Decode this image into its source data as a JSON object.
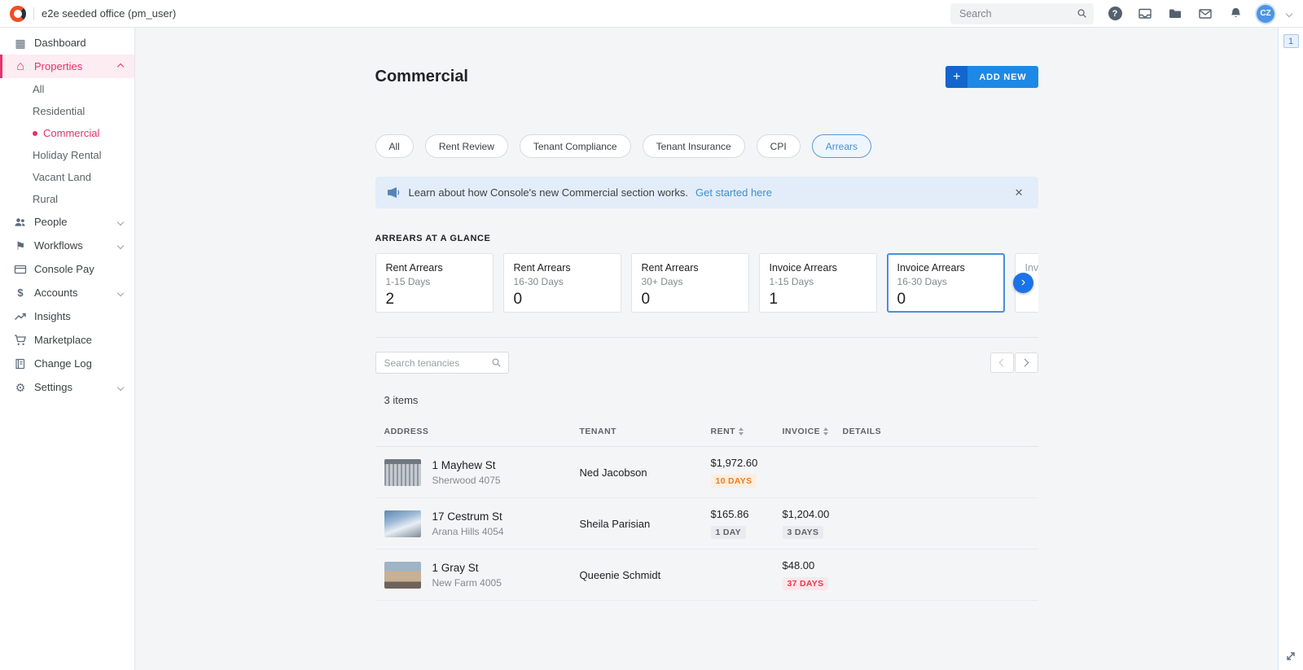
{
  "colors": {
    "brand_pink": "#e8316b",
    "brand_blue": "#1e88e5",
    "accent_blue": "#1a73e8",
    "badge_orange": "#ee7a23",
    "badge_gray": "#5f6368",
    "badge_red": "#e8384f",
    "banner_bg": "#e3edf9"
  },
  "icons": {
    "grid_glyph": "▦",
    "home_glyph": "⌂",
    "flag_glyph": "⚑",
    "gear_glyph": "⚙",
    "dollar_glyph": "$",
    "help_glyph": "?",
    "plus_glyph": "+",
    "close_glyph": "✕",
    "chevron_right_glyph": "›"
  },
  "topbar": {
    "workspace": "e2e seeded office (pm_user)",
    "search_placeholder": "Search",
    "avatar": "CZ"
  },
  "sidebar": {
    "items": [
      {
        "icon": "grid-icon",
        "label": "Dashboard"
      },
      {
        "icon": "home-icon",
        "label": "Properties",
        "active": true,
        "expanded": true
      },
      {
        "icon": "people-icon",
        "label": "People",
        "expandable": true
      },
      {
        "icon": "flag-icon",
        "label": "Workflows",
        "expandable": true
      },
      {
        "icon": "card-icon",
        "label": "Console Pay"
      },
      {
        "icon": "dollar-icon",
        "label": "Accounts",
        "expandable": true
      },
      {
        "icon": "trend-icon",
        "label": "Insights"
      },
      {
        "icon": "cart-icon",
        "label": "Marketplace"
      },
      {
        "icon": "book-icon",
        "label": "Change Log"
      },
      {
        "icon": "gear-icon",
        "label": "Settings",
        "expandable": true
      }
    ],
    "properties_sub": [
      {
        "label": "All"
      },
      {
        "label": "Residential"
      },
      {
        "label": "Commercial",
        "active": true
      },
      {
        "label": "Holiday Rental"
      },
      {
        "label": "Vacant Land"
      },
      {
        "label": "Rural"
      }
    ]
  },
  "main": {
    "page_title": "Commercial",
    "add_new_label": "ADD NEW",
    "filters": [
      {
        "label": "All"
      },
      {
        "label": "Rent Review"
      },
      {
        "label": "Tenant Compliance"
      },
      {
        "label": "Tenant Insurance"
      },
      {
        "label": "CPI"
      },
      {
        "label": "Arrears",
        "active": true
      }
    ],
    "banner": {
      "text": "Learn about how Console's new Commercial section works.",
      "link_text": "Get started here"
    },
    "glance": {
      "heading": "ARREARS AT A GLANCE",
      "highlighted_card_index": 4,
      "cards": [
        {
          "title": "Rent Arrears",
          "subtitle": "1-15 Days",
          "value": "2"
        },
        {
          "title": "Rent Arrears",
          "subtitle": "16-30 Days",
          "value": "0"
        },
        {
          "title": "Rent Arrears",
          "subtitle": "30+ Days",
          "value": "0"
        },
        {
          "title": "Invoice Arrears",
          "subtitle": "1-15 Days",
          "value": "1"
        },
        {
          "title": "Invoice Arrears",
          "subtitle": "16-30 Days",
          "value": "0"
        },
        {
          "title": "Invoice Arrears",
          "subtitle": "",
          "value": ""
        }
      ]
    },
    "tenancies": {
      "search_placeholder": "Search tenancies",
      "items_count": "3 items",
      "columns": [
        {
          "label": "ADDRESS"
        },
        {
          "label": "TENANT"
        },
        {
          "label": "RENT",
          "sortable": true
        },
        {
          "label": "INVOICE",
          "sortable": true
        },
        {
          "label": "DETAILS"
        }
      ],
      "rows": [
        {
          "address": "1 Mayhew St",
          "locality": "Sherwood 4075",
          "tenant": "Ned Jacobson",
          "rent_amount": "$1,972.60",
          "rent_badge": "10 DAYS",
          "rent_badge_type": "orange",
          "invoice_amount": "",
          "invoice_badge": "",
          "invoice_badge_type": ""
        },
        {
          "address": "17 Cestrum St",
          "locality": "Arana Hills 4054",
          "tenant": "Sheila Parisian",
          "rent_amount": "$165.86",
          "rent_badge": "1 DAY",
          "rent_badge_type": "gray",
          "invoice_amount": "$1,204.00",
          "invoice_badge": "3 DAYS",
          "invoice_badge_type": "gray"
        },
        {
          "address": "1 Gray St",
          "locality": "New Farm 4005",
          "tenant": "Queenie Schmidt",
          "rent_amount": "",
          "rent_badge": "",
          "rent_badge_type": "",
          "invoice_amount": "$48.00",
          "invoice_badge": "37 DAYS",
          "invoice_badge_type": "red"
        }
      ]
    }
  },
  "rail": {
    "page_indicator": "1"
  }
}
